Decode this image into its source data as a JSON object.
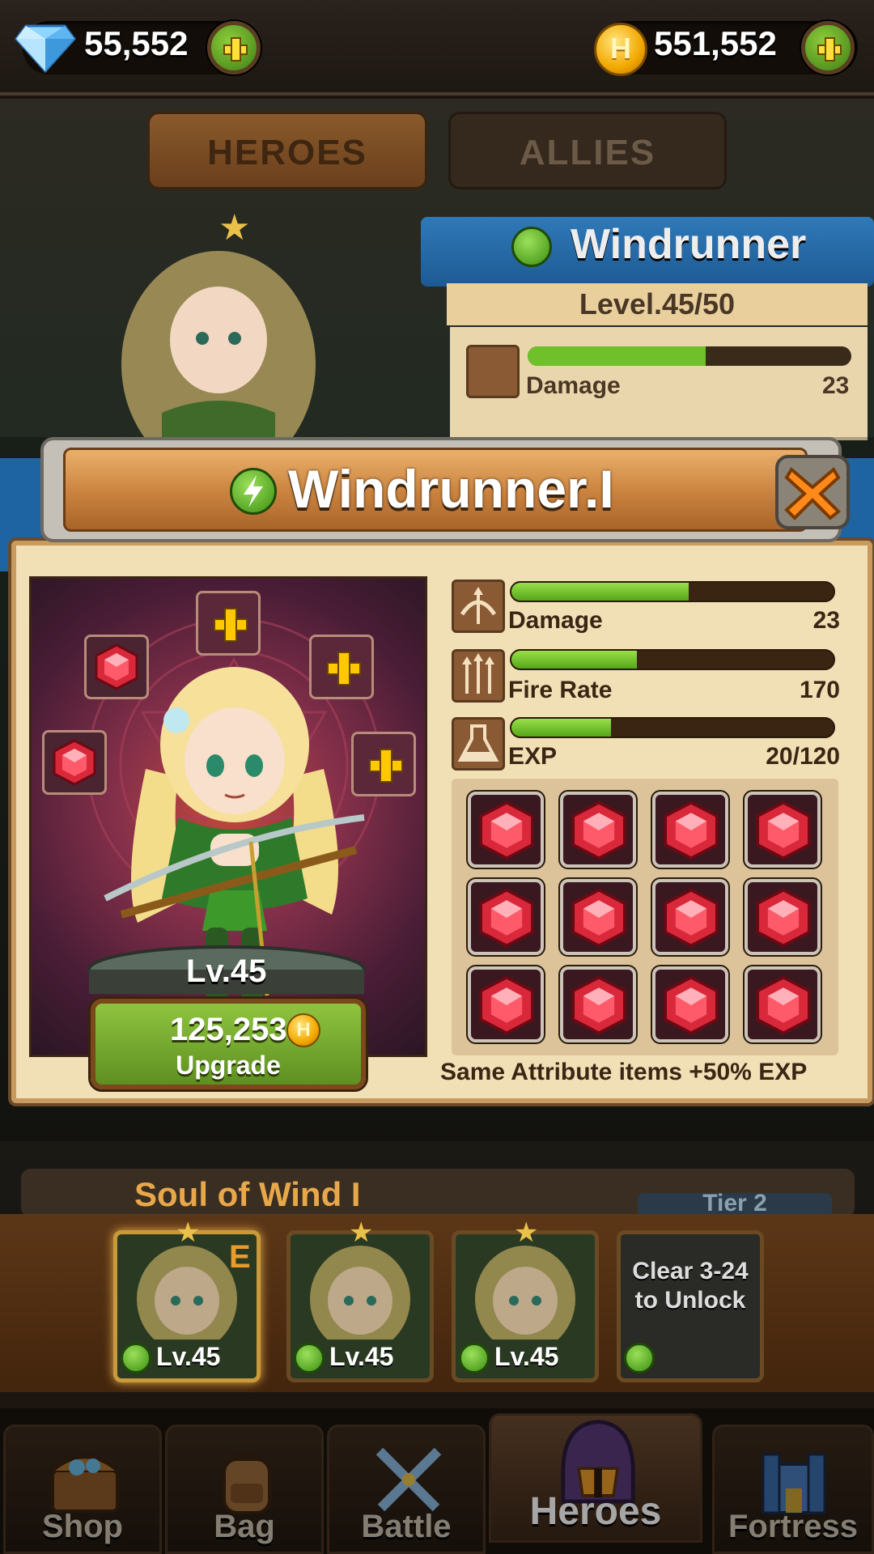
{
  "currency": {
    "gems": "55,552",
    "gold": "551,552",
    "gold_coin_letter": "H",
    "gem_icon": "diamond-gem-icon",
    "coin_icon": "gold-coin-icon"
  },
  "tabs": [
    {
      "label": "HEROES",
      "active": true
    },
    {
      "label": "ALLIES",
      "active": false
    }
  ],
  "background_panel": {
    "hero_name": "Windrunner",
    "level": "Level.45/50",
    "stats": [
      {
        "label": "Damage",
        "value": "23",
        "fill": 0.55
      }
    ],
    "soul_text": "Soul of Wind I",
    "tier_text": "Tier 2"
  },
  "modal": {
    "title": "Windrunner.I",
    "hero_level": "Lv.45",
    "upgrade_cost": "125,253",
    "upgrade_coin_letter": "H",
    "upgrade_label": "Upgrade",
    "stats": [
      {
        "label": "Damage",
        "value": "23",
        "fill": 0.55,
        "icon": "bow-icon"
      },
      {
        "label": "Fire Rate",
        "value": "170",
        "fill": 0.39,
        "icon": "arrows-icon"
      },
      {
        "label": "EXP",
        "value": "20/120",
        "fill": 0.31,
        "icon": "flask-icon"
      }
    ],
    "equip_slots": [
      {
        "slot": "top",
        "state": "empty"
      },
      {
        "slot": "upper-left",
        "state": "ruby"
      },
      {
        "slot": "upper-right",
        "state": "empty"
      },
      {
        "slot": "left",
        "state": "ruby"
      },
      {
        "slot": "right",
        "state": "empty"
      }
    ],
    "inventory_gem_count": 12,
    "hint": "Same Attribute items +50% EXP"
  },
  "roster": [
    {
      "level": "Lv.45",
      "selected": true,
      "badge": "E",
      "locked": false
    },
    {
      "level": "Lv.45",
      "selected": false,
      "locked": false
    },
    {
      "level": "Lv.45",
      "selected": false,
      "locked": false
    },
    {
      "locked": true,
      "lock_text": "Clear 3-24 to Unlock"
    }
  ],
  "nav": [
    {
      "label": "Shop",
      "icon": "treasure-chest-icon"
    },
    {
      "label": "Bag",
      "icon": "backpack-icon"
    },
    {
      "label": "Battle",
      "icon": "crossed-swords-icon"
    },
    {
      "label": "Heroes",
      "icon": "helmet-icon",
      "active": true
    },
    {
      "label": "Fortress",
      "icon": "fortress-icon"
    }
  ],
  "colors": {
    "bar_fill": "#6fc02a",
    "ribbon_blue": "#1e63a2",
    "panel_parchment": "#f1dfb6",
    "upgrade_green": "#7cb22f",
    "ruby": "#d8283a"
  }
}
